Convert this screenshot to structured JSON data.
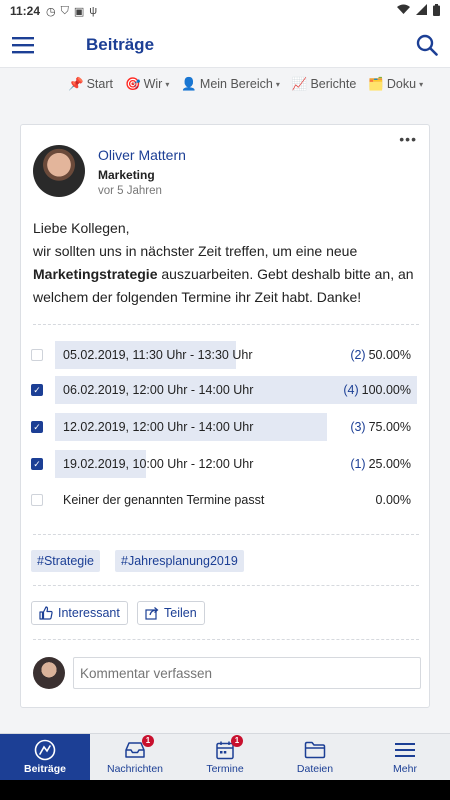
{
  "status_bar": {
    "time": "11:24",
    "icons": [
      "clock-icon",
      "shield-icon",
      "sim-icon",
      "usb-icon"
    ],
    "right_icons": [
      "wifi-icon",
      "signal-icon",
      "battery-icon"
    ]
  },
  "app_bar": {
    "title": "Beiträge",
    "menu_icon": "hamburger-icon",
    "search_icon": "search-icon"
  },
  "subnav": {
    "items": [
      {
        "icon": "📌",
        "label": "Start",
        "has_caret": false
      },
      {
        "icon": "🎯",
        "label": "Wir",
        "has_caret": true
      },
      {
        "icon": "👤",
        "label": "Mein Bereich",
        "has_caret": true
      },
      {
        "icon": "📈",
        "label": "Berichte",
        "has_caret": false
      },
      {
        "icon": "🗂️",
        "label": "Doku",
        "has_caret": true
      }
    ],
    "caret": "▾"
  },
  "post": {
    "author": "Oliver Mattern",
    "department": "Marketing",
    "time_ago": "vor 5 Jahren",
    "more": "•••",
    "body": {
      "line1": "Liebe Kollegen,",
      "line2a": "wir sollten uns in nächster Zeit treffen, um eine neue",
      "bold": "Marketingstrategie",
      "line2b": " auszuarbeiten. Gebt deshalb bitte an, an welchem der folgenden Termine ihr Zeit habt. Danke!"
    },
    "poll": [
      {
        "label": "05.02.2019, 11:30 Uhr - 13:30 Uhr",
        "count": "(2)",
        "percent": "50.00%",
        "fraction": 0.5,
        "checked": false
      },
      {
        "label": "06.02.2019, 12:00 Uhr - 14:00 Uhr",
        "count": "(4)",
        "percent": "100.00%",
        "fraction": 1.0,
        "checked": true
      },
      {
        "label": "12.02.2019, 12:00 Uhr - 14:00 Uhr",
        "count": "(3)",
        "percent": "75.00%",
        "fraction": 0.75,
        "checked": true
      },
      {
        "label": "19.02.2019, 10:00 Uhr - 12:00 Uhr",
        "count": "(1)",
        "percent": "25.00%",
        "fraction": 0.25,
        "checked": true
      },
      {
        "label": "Keiner der genannten Termine passt",
        "count": "",
        "percent": "0.00%",
        "fraction": 0.0,
        "checked": false
      }
    ],
    "tags": [
      "#Strategie",
      "#Jahresplanung2019"
    ],
    "actions": {
      "interesting": "Interessant",
      "share": "Teilen"
    },
    "comment_placeholder": "Kommentar verfassen"
  },
  "bottom_nav": [
    {
      "label": "Beiträge",
      "icon": "posts-icon",
      "active": true,
      "badge": ""
    },
    {
      "label": "Nachrichten",
      "icon": "inbox-icon",
      "active": false,
      "badge": "1"
    },
    {
      "label": "Termine",
      "icon": "calendar-icon",
      "active": false,
      "badge": "1"
    },
    {
      "label": "Dateien",
      "icon": "folder-icon",
      "active": false,
      "badge": ""
    },
    {
      "label": "Mehr",
      "icon": "hamburger-icon",
      "active": false,
      "badge": ""
    }
  ],
  "colors": {
    "brand": "#1c3f95",
    "poll_bar": "#e3e8f3",
    "badge": "#c8102e"
  }
}
